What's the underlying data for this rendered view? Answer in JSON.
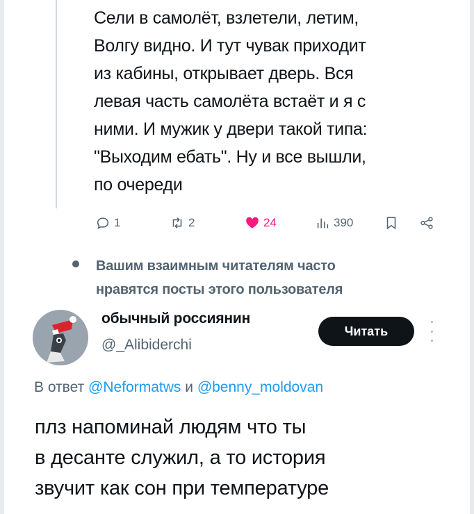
{
  "tweet": {
    "text_lines": [
      "Сели в самолёт, взлетели, летим,",
      "Волгу видно.  И тут чувак приходит",
      "из кабины, открывает дверь. Вся",
      "левая часть самолёта встаёт и я с",
      "ними. И мужик у двери такой типа:",
      "\"Выходим ебать\". Ну и все вышли,",
      "по очереди"
    ],
    "actions": {
      "replies": "1",
      "retweets": "2",
      "likes": "24",
      "views": "390"
    },
    "icons": [
      "reply-icon",
      "retweet-icon",
      "heart-icon",
      "views-icon",
      "bookmark-icon",
      "share-icon"
    ],
    "like_color": "#f91880"
  },
  "suggestion": {
    "lines": [
      "Вашим взаимным читателям часто",
      "нравятся посты этого пользователя"
    ]
  },
  "user": {
    "name": "обычный россиянин",
    "handle": "@_Alibiderchi",
    "follow_label": "Читать"
  },
  "reply": {
    "prefix": "В ответ",
    "mention1": "@Neformatws",
    "conj": "и",
    "mention2": "@benny_moldovan",
    "text_lines": [
      "плз напоминай людям что ты",
      "в десанте служил, а то история",
      "звучит как сон при температуре"
    ]
  },
  "colors": {
    "text": "#0f1419",
    "secondary": "#536471",
    "link": "#1d9bf0",
    "button_bg": "#0f1419"
  }
}
